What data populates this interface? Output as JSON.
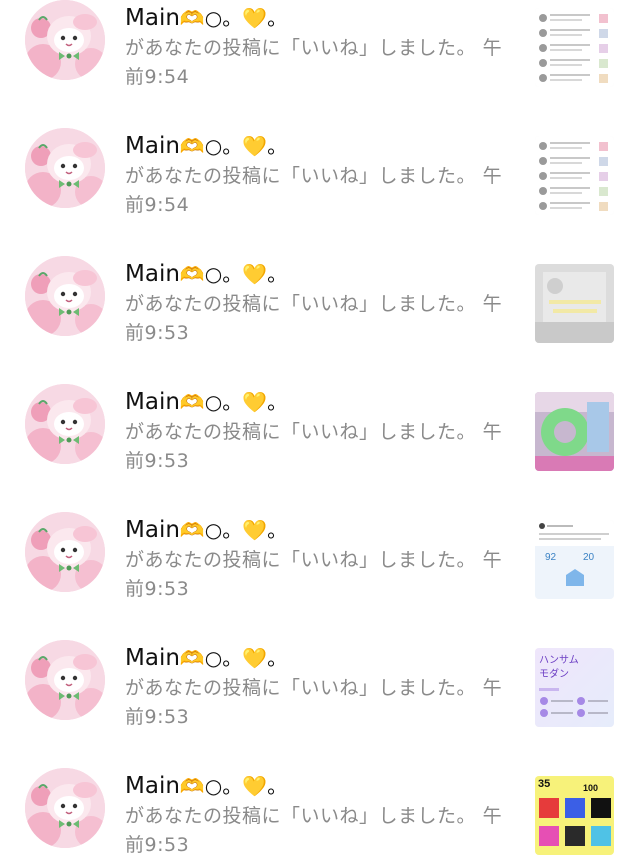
{
  "notifications": [
    {
      "user_name": "Main",
      "user_emoji": "🫶○。💛。",
      "message": "があなたの投稿に「いいね」しました。",
      "time": "午前9:54",
      "thumbnail": "post-thumbnail-list-screenshot"
    },
    {
      "user_name": "Main",
      "user_emoji": "🫶○。💛。",
      "message": "があなたの投稿に「いいね」しました。",
      "time": "午前9:54",
      "thumbnail": "post-thumbnail-list-screenshot"
    },
    {
      "user_name": "Main",
      "user_emoji": "🫶○。💛。",
      "message": "があなたの投稿に「いいね」しました。",
      "time": "午前9:53",
      "thumbnail": "post-thumbnail-gray-card"
    },
    {
      "user_name": "Main",
      "user_emoji": "🫶○。💛。",
      "message": "があなたの投稿に「いいね」しました。",
      "time": "午前9:53",
      "thumbnail": "post-thumbnail-green-ring-photo"
    },
    {
      "user_name": "Main",
      "user_emoji": "🫶○。💛。",
      "message": "があなたの投稿に「いいね」しました。",
      "time": "午前9:53",
      "thumbnail": "post-thumbnail-stats-card",
      "thumb_text": [
        "92",
        "20"
      ]
    },
    {
      "user_name": "Main",
      "user_emoji": "🫶○。💛。",
      "message": "があなたの投稿に「いいね」しました。",
      "time": "午前9:53",
      "thumbnail": "post-thumbnail-purple-card",
      "thumb_text": [
        "ハンサム",
        "モダン"
      ]
    },
    {
      "user_name": "Main",
      "user_emoji": "🫶○。💛。",
      "message": "があなたの投稿に「いいね」しました。",
      "time": "午前9:53",
      "thumbnail": "post-thumbnail-colorful-grid",
      "thumb_text": [
        "35",
        "100"
      ]
    }
  ],
  "colors": {
    "name_text": "#111111",
    "message_text": "#8a8a8a",
    "avatar_pink": "#f3b6c9"
  }
}
